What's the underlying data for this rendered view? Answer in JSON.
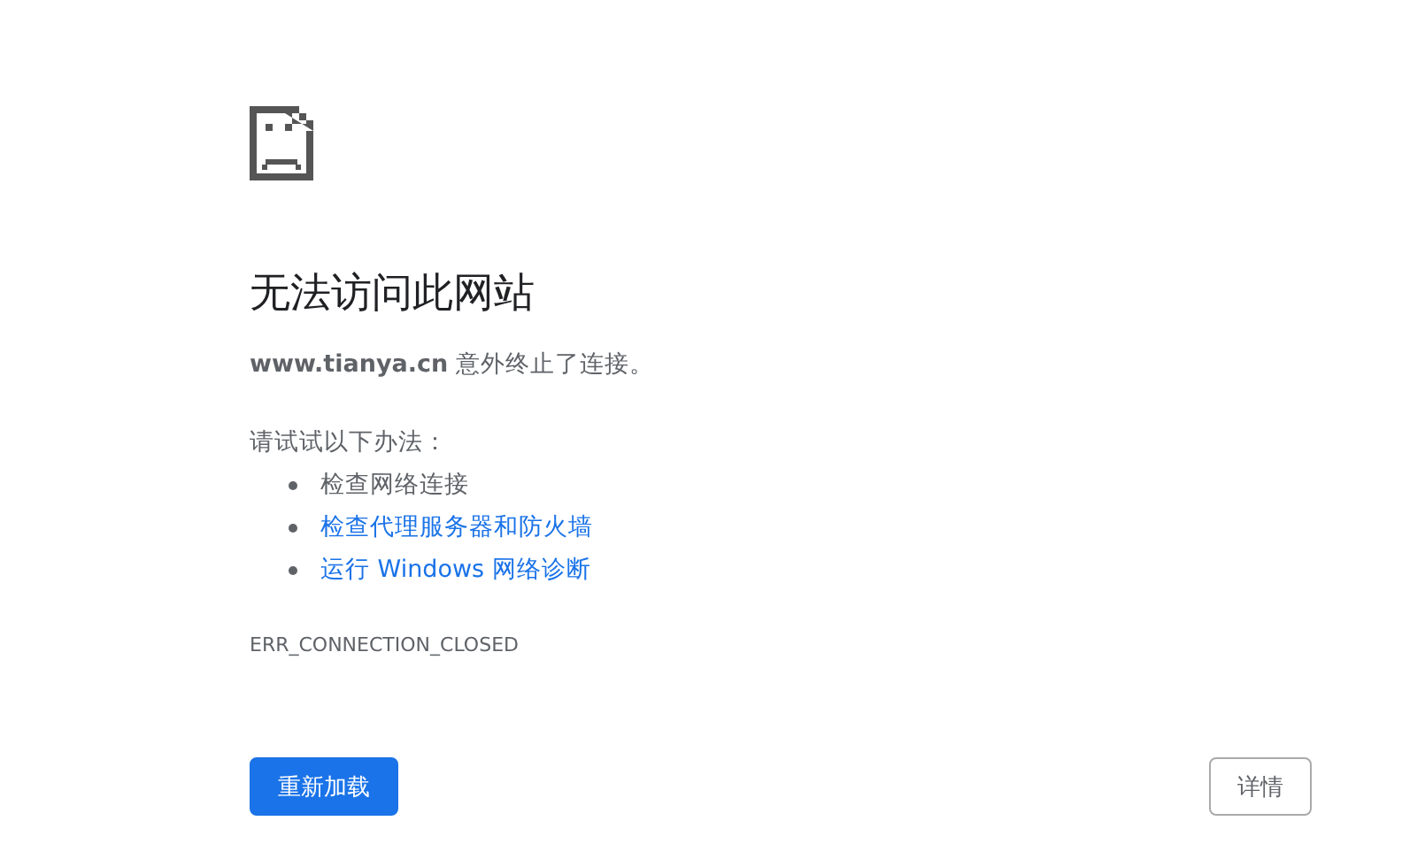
{
  "heading": "无法访问此网站",
  "summary": "**www.tianya.cn** 意外终止了连接。",
  "suggestions_intro": "请试试以下办法：",
  "suggestions": [
    {
      "text": "检查网络连接",
      "link": false
    },
    {
      "text": "检查代理服务器和防火墙",
      "link": true
    },
    {
      "text": "运行 Windows 网络诊断",
      "link": true
    }
  ],
  "error_code": "ERR_CONNECTION_CLOSED",
  "buttons": [
    {
      "label": "重新加载",
      "kind": "primary"
    },
    {
      "label": "详情",
      "kind": "secondary"
    }
  ]
}
